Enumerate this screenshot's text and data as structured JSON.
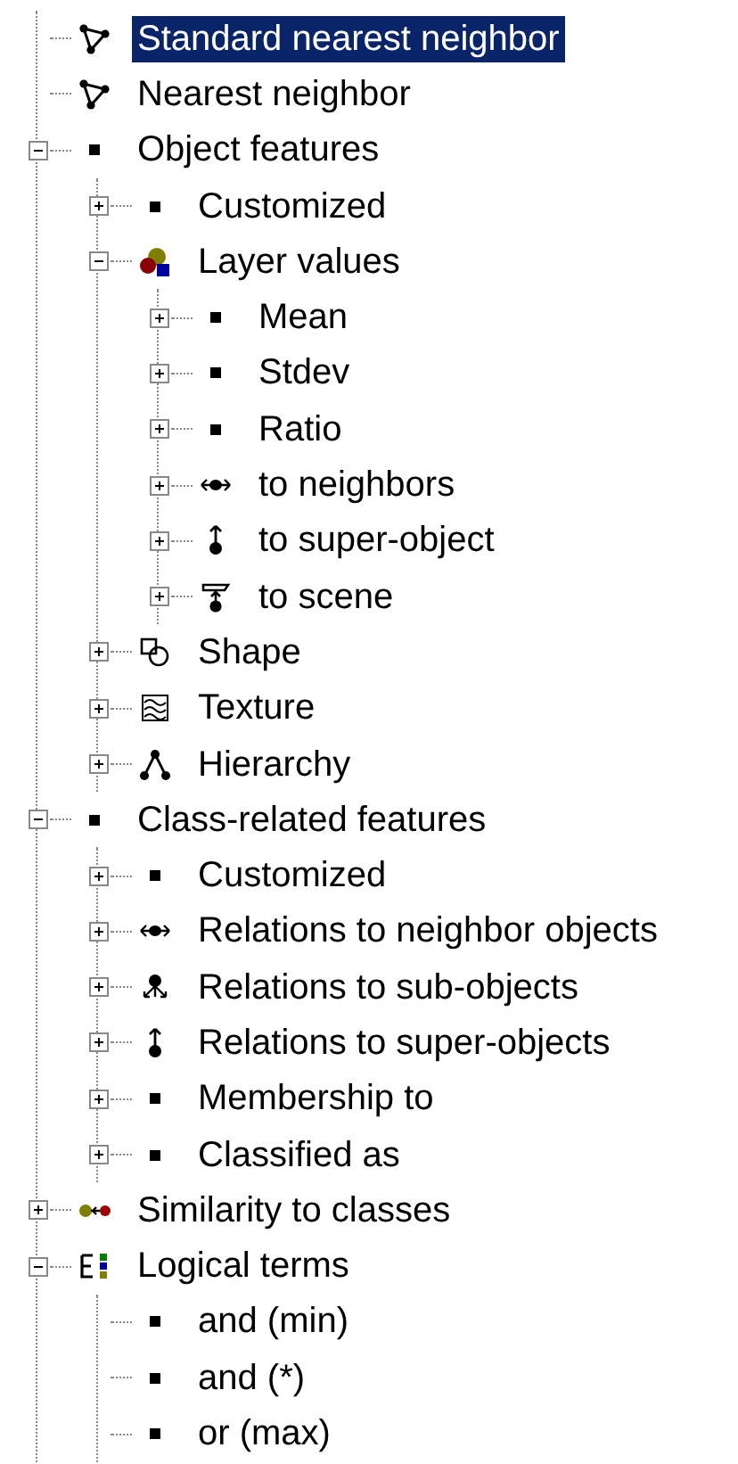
{
  "tree": [
    {
      "label": "Standard nearest neighbor",
      "kind": "network",
      "selected": true
    },
    {
      "label": "Nearest neighbor",
      "kind": "network",
      "selected": false
    },
    {
      "label": "Object features",
      "kind": "dot",
      "selected": false,
      "expanded": true,
      "children": [
        {
          "label": "Customized",
          "kind": "dot",
          "selected": false,
          "expanded": false
        },
        {
          "label": "Layer values",
          "kind": "layers",
          "selected": false,
          "expanded": true,
          "children": [
            {
              "label": "Mean",
              "kind": "dot",
              "selected": false,
              "expanded": false
            },
            {
              "label": "Stdev",
              "kind": "dot",
              "selected": false,
              "expanded": false
            },
            {
              "label": "Ratio",
              "kind": "dot",
              "selected": false,
              "expanded": false
            },
            {
              "label": "to neighbors",
              "kind": "neighbors",
              "selected": false,
              "expanded": false
            },
            {
              "label": "to super-object",
              "kind": "super",
              "selected": false,
              "expanded": false
            },
            {
              "label": "to scene",
              "kind": "scene",
              "selected": false,
              "expanded": false
            }
          ]
        },
        {
          "label": "Shape",
          "kind": "shape",
          "selected": false,
          "expanded": false
        },
        {
          "label": "Texture",
          "kind": "texture",
          "selected": false,
          "expanded": false
        },
        {
          "label": "Hierarchy",
          "kind": "hierarchy",
          "selected": false,
          "expanded": false
        }
      ]
    },
    {
      "label": "Class-related features",
      "kind": "dot",
      "selected": false,
      "expanded": true,
      "children": [
        {
          "label": "Customized",
          "kind": "dot",
          "selected": false,
          "expanded": false
        },
        {
          "label": "Relations to neighbor objects",
          "kind": "neighbors",
          "selected": false,
          "expanded": false
        },
        {
          "label": "Relations to sub-objects",
          "kind": "sub",
          "selected": false,
          "expanded": false
        },
        {
          "label": "Relations to super-objects",
          "kind": "super",
          "selected": false,
          "expanded": false
        },
        {
          "label": "Membership to",
          "kind": "dot",
          "selected": false,
          "expanded": false
        },
        {
          "label": "Classified as",
          "kind": "dot",
          "selected": false,
          "expanded": false
        }
      ]
    },
    {
      "label": "Similarity to classes",
      "kind": "similarity",
      "selected": false,
      "expanded": false
    },
    {
      "label": "Logical terms",
      "kind": "logical",
      "selected": false,
      "expanded": true,
      "children": [
        {
          "label": "and (min)",
          "kind": "dot",
          "selected": false
        },
        {
          "label": "and (*)",
          "kind": "dot",
          "selected": false
        },
        {
          "label": "or (max)",
          "kind": "dot",
          "selected": false
        }
      ]
    }
  ]
}
